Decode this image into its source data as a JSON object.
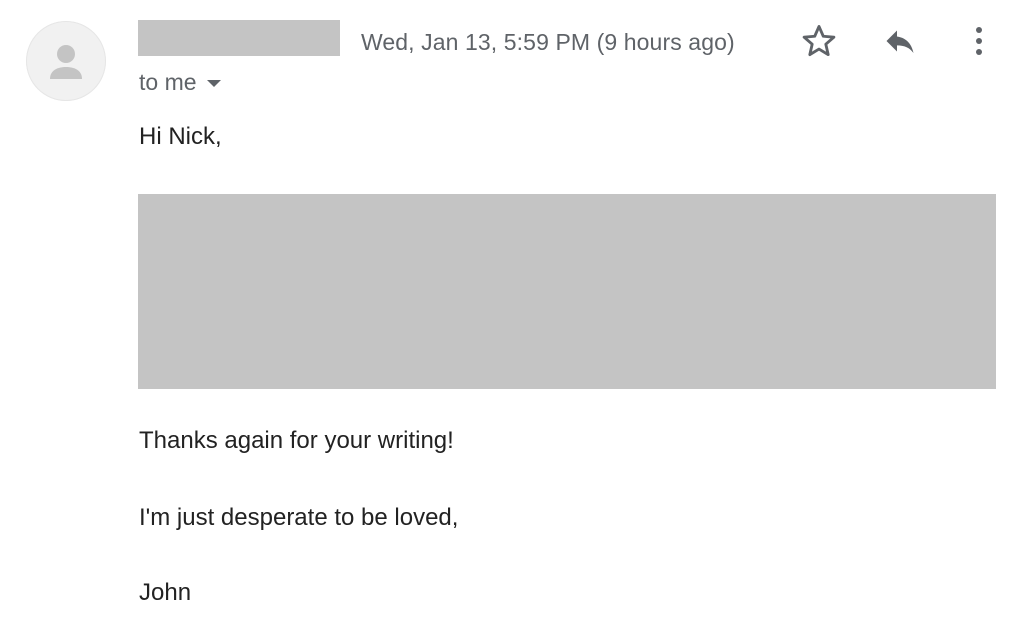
{
  "message": {
    "timestamp": "Wed, Jan 13, 5:59 PM (9 hours ago)",
    "recipient_label": "to me",
    "greeting": "Hi Nick,",
    "body_lines": [
      "Thanks again for your writing!",
      "I'm just desperate to be loved,"
    ],
    "signature": "John"
  },
  "icons": {
    "avatar": "person-icon",
    "star": "star-outline-icon",
    "reply": "reply-icon",
    "more": "more-vertical-icon",
    "recipient_dropdown": "caret-down-icon"
  },
  "colors": {
    "redaction": "#c4c4c4",
    "secondary_text": "#5f6368",
    "primary_text": "#222222",
    "avatar_background": "#f1f1f1"
  }
}
